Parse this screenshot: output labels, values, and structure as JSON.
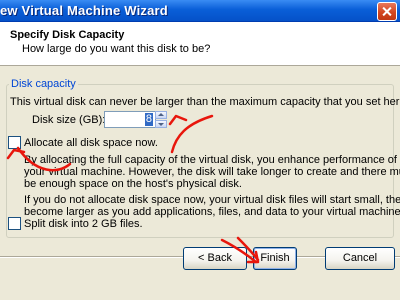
{
  "window": {
    "title": "ew Virtual Machine Wizard",
    "close_icon": "close-icon"
  },
  "header": {
    "title": "Specify Disk Capacity",
    "subtitle": "How large do you want this disk to be?"
  },
  "disk_capacity": {
    "legend": "Disk capacity",
    "intro": "This virtual disk can never be larger than the maximum capacity that you set here.",
    "size_label": "Disk size (GB):",
    "size_value": "8",
    "allocate_label": "Allocate all disk space now.",
    "allocate_checked": false,
    "allocate_desc_line1": "By allocating the full capacity of the virtual disk, you enhance performance of",
    "allocate_desc_line2": "your virtual machine.  However, the disk will take longer to create and there must",
    "allocate_desc_line3": "be enough space on the host's physical disk.",
    "no_alloc_line1": "If you do not allocate disk space now, your virtual disk files will start small, then",
    "no_alloc_line2": "become larger as you add applications, files, and data to your virtual machine.",
    "split_label": "Split disk into 2 GB files.",
    "split_checked": false
  },
  "buttons": {
    "back": "< Back",
    "finish": "Finish",
    "cancel": "Cancel"
  },
  "annotations": {
    "arrow_color": "#e8160c"
  }
}
